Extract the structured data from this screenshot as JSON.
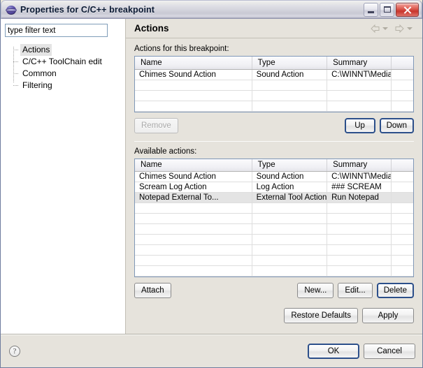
{
  "window": {
    "title": "Properties for C/C++ breakpoint",
    "icon": "eclipse-sphere-icon",
    "controls": {
      "minimize": "Minimize",
      "maximize": "Maximize",
      "close": "Close"
    }
  },
  "sidebar": {
    "filter": {
      "value": "type filter text",
      "placeholder": "type filter text"
    },
    "items": [
      {
        "label": "Actions",
        "selected": true
      },
      {
        "label": "C/C++ ToolChain edit",
        "selected": false
      },
      {
        "label": "Common",
        "selected": false
      },
      {
        "label": "Filtering",
        "selected": false
      }
    ]
  },
  "main": {
    "title": "Actions",
    "nav": {
      "back": "back-arrow",
      "back_menu": "back-dropdown",
      "forward": "forward-arrow",
      "forward_menu": "forward-dropdown"
    },
    "assigned": {
      "label": "Actions for this breakpoint:",
      "columns": [
        "Name",
        "Type",
        "Summary",
        ""
      ],
      "rows": [
        {
          "name": "Chimes Sound Action",
          "type": "Sound Action",
          "summary": "C:\\WINNT\\Media\\ch...",
          "extra": "",
          "selected": false
        }
      ],
      "empty_rows": 3,
      "buttons": {
        "remove": {
          "label": "Remove",
          "enabled": false
        },
        "up": {
          "label": "Up",
          "enabled": true,
          "focused": true
        },
        "down": {
          "label": "Down",
          "enabled": true,
          "focused": true
        }
      }
    },
    "available": {
      "label": "Available actions:",
      "columns": [
        "Name",
        "Type",
        "Summary",
        ""
      ],
      "rows": [
        {
          "name": "Chimes Sound Action",
          "type": "Sound Action",
          "summary": "C:\\WINNT\\Media\\ch...",
          "extra": "",
          "selected": false
        },
        {
          "name": "Scream Log Action",
          "type": "Log Action",
          "summary": "### SCREAM",
          "extra": "",
          "selected": false
        },
        {
          "name": "Notepad External To...",
          "type": "External Tool Action",
          "summary": "Run Notepad",
          "extra": "",
          "selected": true
        }
      ],
      "empty_rows": 7,
      "buttons": {
        "attach": {
          "label": "Attach",
          "enabled": true
        },
        "new": {
          "label": "New...",
          "enabled": true
        },
        "edit": {
          "label": "Edit...",
          "enabled": true
        },
        "delete": {
          "label": "Delete",
          "enabled": true,
          "focused": true
        }
      }
    },
    "page_buttons": {
      "restore_defaults": {
        "label": "Restore Defaults",
        "enabled": true
      },
      "apply": {
        "label": "Apply",
        "enabled": true
      }
    }
  },
  "footer": {
    "help": {
      "icon": "help-question-icon",
      "label": "?"
    },
    "ok": {
      "label": "OK",
      "focused": true
    },
    "cancel": {
      "label": "Cancel",
      "focused": false
    }
  }
}
